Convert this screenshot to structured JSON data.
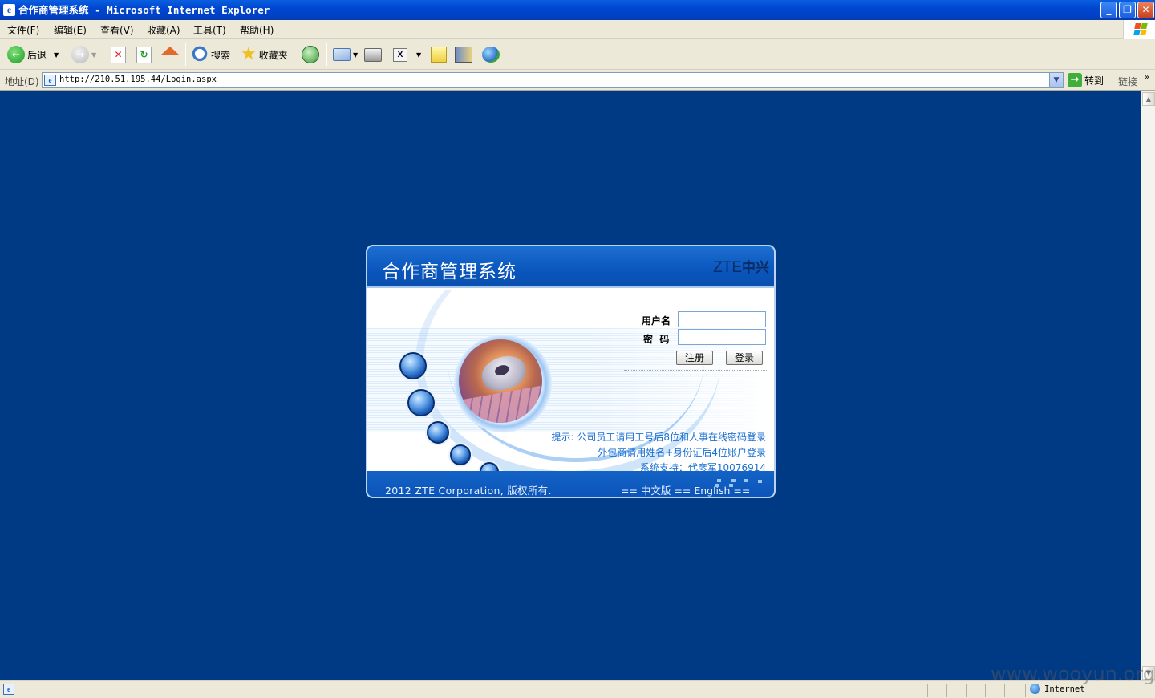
{
  "window": {
    "title": "合作商管理系统 - Microsoft Internet Explorer",
    "min_label": "_",
    "max_label": "❐",
    "close_label": "✕"
  },
  "menu": {
    "items": [
      "文件(F)",
      "编辑(E)",
      "查看(V)",
      "收藏(A)",
      "工具(T)",
      "帮助(H)"
    ]
  },
  "toolbar": {
    "back_label": "后退",
    "search_label": "搜索",
    "favorites_label": "收藏夹"
  },
  "address": {
    "label": "地址(D)",
    "url": "http://210.51.195.44/Login.aspx",
    "go_label": "转到",
    "links_label": "链接"
  },
  "login": {
    "title": "合作商管理系统",
    "logo_text": "ZTE",
    "logo_cn": "中兴",
    "username_label": "用户名",
    "password_label": "密  码",
    "username_value": "",
    "password_value": "",
    "register_label": "注册",
    "login_label": "登录",
    "tip_line1": "提示: 公司员工请用工号后8位和人事在线密码登录",
    "tip_line2": "外包商请用姓名+身份证后4位账户登录",
    "tip_line3": "系统支持：代彦军10076914",
    "copyright": "2012 ZTE Corporation, 版权所有.",
    "lang_links": "== 中文版 == English =="
  },
  "status": {
    "zone": "Internet"
  },
  "watermark": "www.wooyun.org",
  "colors": {
    "page_background": "#003a85",
    "panel_header": "#0a56bd",
    "tip_text": "#1a6fd0"
  }
}
